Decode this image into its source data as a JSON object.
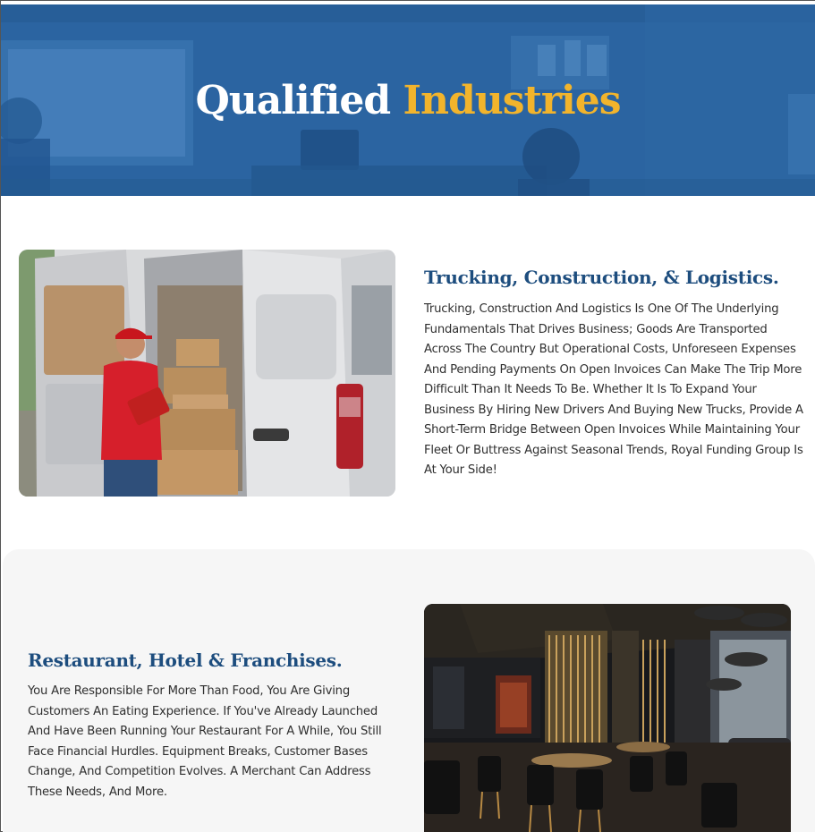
{
  "hero": {
    "title_main": "Qualified",
    "title_accent": "Industries",
    "colors": {
      "background": "#2a63a0",
      "accent": "#f2b42c"
    }
  },
  "sections": [
    {
      "heading": "Trucking, Construction, & Logistics.",
      "body": "Trucking, Construction And Logistics Is One Of The Underlying Fundamentals That Drives Business; Goods Are Transported Across The Country But Operational Costs, Unforeseen Expenses And Pending Payments On Open Invoices Can Make The Trip More Difficult Than It Needs To Be. Whether It Is To Expand Your Business By Hiring New Drivers And Buying New Trucks, Provide A Short-Term Bridge Between Open Invoices While Maintaining Your Fleet Or Buttress Against Seasonal Trends, Royal Funding Group Is At Your Side!",
      "image": "delivery-van-photo"
    },
    {
      "heading": "Restaurant, Hotel & Franchises.",
      "body": "You Are Responsible For More Than Food, You Are Giving Customers An Eating Experience. If You've Already Launched And Have Been Running Your Restaurant For A While, You Still Face Financial Hurdles. Equipment Breaks, Customer Bases Change, And Competition Evolves. A Merchant Can Address These Needs, And More.",
      "image": "restaurant-interior-photo"
    }
  ],
  "colors": {
    "heading": "#1d4d7e",
    "body_text": "#2f2f2f",
    "section_bg": "#f6f6f6"
  }
}
